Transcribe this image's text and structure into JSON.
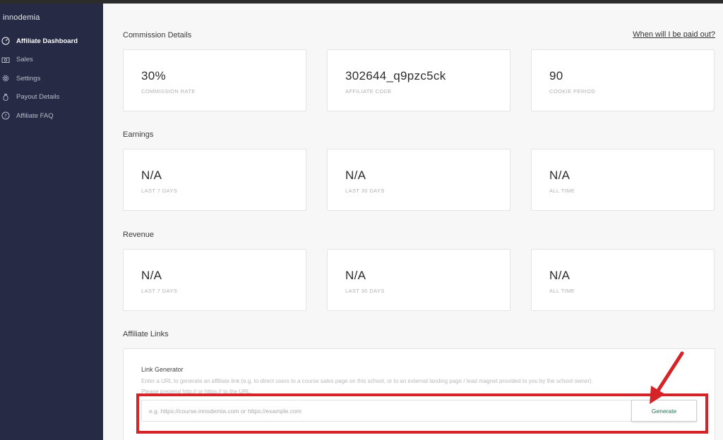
{
  "sidebar": {
    "brand": "innodemia",
    "items": [
      {
        "label": "Affiliate Dashboard",
        "icon": "dashboard-icon",
        "active": true
      },
      {
        "label": "Sales",
        "icon": "sales-icon"
      },
      {
        "label": "Settings",
        "icon": "gear-icon"
      },
      {
        "label": "Payout Details",
        "icon": "money-bag-icon"
      },
      {
        "label": "Affiliate FAQ",
        "icon": "help-icon"
      }
    ]
  },
  "commission": {
    "title": "Commission Details",
    "paid_link": "When will I be paid out?",
    "cards": [
      {
        "value": "30%",
        "label": "COMMISSION RATE"
      },
      {
        "value": "302644_q9pzc5ck",
        "label": "AFFILIATE CODE"
      },
      {
        "value": "90",
        "label": "COOKIE PERIOD"
      }
    ]
  },
  "earnings": {
    "title": "Earnings",
    "cards": [
      {
        "value": "N/A",
        "label": "LAST 7 DAYS"
      },
      {
        "value": "N/A",
        "label": "LAST 30 DAYS"
      },
      {
        "value": "N/A",
        "label": "ALL TIME"
      }
    ]
  },
  "revenue": {
    "title": "Revenue",
    "cards": [
      {
        "value": "N/A",
        "label": "LAST 7 DAYS"
      },
      {
        "value": "N/A",
        "label": "LAST 30 DAYS"
      },
      {
        "value": "N/A",
        "label": "ALL TIME"
      }
    ]
  },
  "affiliate_links": {
    "title": "Affiliate Links",
    "generator_title": "Link Generator",
    "description_line1": "Enter a URL to generate an affiliate link (e.g. to direct users to a course sales page on this school, or to an external landing page / lead magnet provided to you by the school owner).",
    "description_line2": "Please prepend http:// or https:// to the URL.",
    "input_placeholder": "e.g. https://course.innodemia.com or https://example.com",
    "button_label": "Generate"
  },
  "colors": {
    "sidebar_bg": "#262a44",
    "highlight": "#d42428",
    "button_text": "#2a6e5a"
  }
}
